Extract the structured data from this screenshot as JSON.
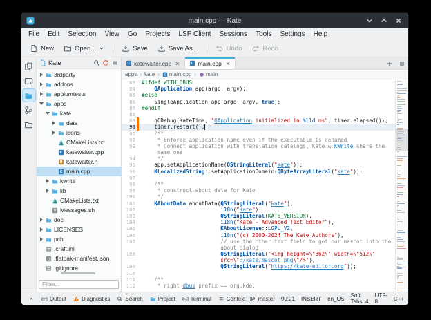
{
  "window": {
    "title": "main.cpp — Kate"
  },
  "menubar": {
    "items": [
      "File",
      "Edit",
      "Selection",
      "View",
      "Go",
      "Projects",
      "LSP Client",
      "Sessions",
      "Tools",
      "Settings",
      "Help"
    ]
  },
  "toolbar": {
    "buttons": [
      {
        "icon": "page",
        "label": "New"
      },
      {
        "icon": "folderdark",
        "label": "Open...",
        "dropdown": true
      },
      {
        "sep": true
      },
      {
        "icon": "save",
        "label": "Save"
      },
      {
        "icon": "save",
        "label": "Save As..."
      },
      {
        "sep": true
      },
      {
        "icon": "undo",
        "label": "Undo",
        "disabled": true
      },
      {
        "icon": "redo",
        "label": "Redo",
        "disabled": true
      }
    ]
  },
  "toolstrip": {
    "items": [
      {
        "name": "documents",
        "icon": "docs"
      },
      {
        "name": "filesystem",
        "icon": "drive"
      },
      {
        "name": "projects",
        "icon": "projects",
        "active": true
      },
      {
        "name": "git",
        "icon": "git"
      },
      {
        "name": "files",
        "icon": "folderdark"
      }
    ]
  },
  "project_panel": {
    "name": "Kate",
    "filter_placeholder": "Filter...",
    "tree": [
      {
        "d": 0,
        "x": "c",
        "i": "folder",
        "label": "3rdparty"
      },
      {
        "d": 0,
        "x": "c",
        "i": "folder",
        "label": "addons"
      },
      {
        "d": 0,
        "x": "c",
        "i": "folder",
        "label": "appiumtests"
      },
      {
        "d": 0,
        "x": "e",
        "i": "folder",
        "label": "apps"
      },
      {
        "d": 1,
        "x": "e",
        "i": "folder",
        "label": "kate"
      },
      {
        "d": 2,
        "x": "c",
        "i": "folder",
        "label": "data"
      },
      {
        "d": 2,
        "x": "c",
        "i": "folder",
        "label": "icons"
      },
      {
        "d": 2,
        "x": "",
        "i": "cmake",
        "label": "CMakeLists.txt"
      },
      {
        "d": 2,
        "x": "",
        "i": "cpp",
        "label": "katewaiter.cpp"
      },
      {
        "d": 2,
        "x": "",
        "i": "h",
        "label": "katewaiter.h"
      },
      {
        "d": 2,
        "x": "",
        "i": "cpp",
        "label": "main.cpp",
        "selected": true
      },
      {
        "d": 1,
        "x": "c",
        "i": "folder",
        "label": "kwrite"
      },
      {
        "d": 1,
        "x": "c",
        "i": "folder",
        "label": "lib"
      },
      {
        "d": 1,
        "x": "",
        "i": "cmake",
        "label": "CMakeLists.txt"
      },
      {
        "d": 1,
        "x": "",
        "i": "sh",
        "label": "Messages.sh"
      },
      {
        "d": 0,
        "x": "c",
        "i": "folder",
        "label": "doc"
      },
      {
        "d": 0,
        "x": "c",
        "i": "folder",
        "label": "LICENSES"
      },
      {
        "d": 0,
        "x": "c",
        "i": "folder",
        "label": "pch"
      },
      {
        "d": 0,
        "x": "",
        "i": "ini",
        "label": ".craft.ini"
      },
      {
        "d": 0,
        "x": "",
        "i": "json",
        "label": ".flatpak-manifest.json"
      },
      {
        "d": 0,
        "x": "",
        "i": "ini",
        "label": ".gitignore"
      }
    ]
  },
  "editor": {
    "tabs": [
      {
        "label": "katewaiter.cpp"
      },
      {
        "label": "main.cpp",
        "active": true
      }
    ],
    "breadcrumb_separator": "›",
    "breadcrumb": [
      {
        "label": "apps"
      },
      {
        "label": "kate"
      },
      {
        "label": "main.cpp",
        "icon": "cpp"
      },
      {
        "label": "main",
        "icon": "symbol"
      }
    ],
    "lines": [
      {
        "n": "83",
        "seg": [
          [
            "pre",
            "#ifdef WITH_DBUS"
          ]
        ]
      },
      {
        "n": "84",
        "seg": [
          [
            "pln",
            "    "
          ],
          [
            "type",
            "QApplication"
          ],
          [
            "pln",
            " app(argc, argv);"
          ]
        ]
      },
      {
        "n": "85",
        "seg": [
          [
            "pre",
            "#else"
          ]
        ]
      },
      {
        "n": "86",
        "seg": [
          [
            "pln",
            "    SingleApplication app(argc, argv, "
          ],
          [
            "kw",
            "true"
          ],
          [
            "pln",
            ");"
          ]
        ]
      },
      {
        "n": "87",
        "seg": [
          [
            "pre",
            "#endif"
          ]
        ]
      },
      {
        "n": "88",
        "seg": []
      },
      {
        "n": "89",
        "mark": true,
        "seg": [
          [
            "pln",
            "    qCDebug(KateTime, "
          ],
          [
            "str",
            "\""
          ],
          [
            "slink",
            "QApplication"
          ],
          [
            "str",
            " initialized in "
          ],
          [
            "fmt",
            "%lld"
          ],
          [
            "str",
            " ms\""
          ],
          [
            "pln",
            ", timer.elapsed());"
          ]
        ]
      },
      {
        "n": "90",
        "cur": true,
        "mark": true,
        "caret": true,
        "seg": [
          [
            "pln",
            "    timer.restart();"
          ]
        ]
      },
      {
        "n": "91",
        "seg": [
          [
            "com",
            "    /**"
          ]
        ]
      },
      {
        "n": "92",
        "seg": [
          [
            "com",
            "     * Enforce application name even if the executable is renamed"
          ]
        ]
      },
      {
        "n": "93",
        "seg": [
          [
            "com",
            "     * Connect application with translation catalogs, Kate & "
          ],
          [
            "comlink",
            "KWrite"
          ],
          [
            "com",
            " share the"
          ]
        ]
      },
      {
        "n": "",
        "seg": [
          [
            "com",
            "     same one"
          ]
        ]
      },
      {
        "n": "94",
        "seg": [
          [
            "com",
            "     */"
          ]
        ]
      },
      {
        "n": "95",
        "seg": [
          [
            "pln",
            "    app.setApplicationName("
          ],
          [
            "type",
            "QStringLiteral"
          ],
          [
            "pln",
            "("
          ],
          [
            "str",
            "\""
          ],
          [
            "slink",
            "kate"
          ],
          [
            "str",
            "\""
          ],
          [
            "pln",
            "));"
          ]
        ]
      },
      {
        "n": "96",
        "seg": [
          [
            "pln",
            "    "
          ],
          [
            "type",
            "KLocalizedString"
          ],
          [
            "pln",
            "::setApplicationDomain("
          ],
          [
            "type",
            "QByteArrayLiteral"
          ],
          [
            "pln",
            "("
          ],
          [
            "str",
            "\""
          ],
          [
            "slink",
            "kate"
          ],
          [
            "str",
            "\""
          ],
          [
            "pln",
            "));"
          ]
        ]
      },
      {
        "n": "97",
        "seg": []
      },
      {
        "n": "98",
        "seg": [
          [
            "com",
            "    /**"
          ]
        ]
      },
      {
        "n": "99",
        "seg": [
          [
            "com",
            "     * construct about data for Kate"
          ]
        ]
      },
      {
        "n": "100",
        "seg": [
          [
            "com",
            "     */"
          ]
        ]
      },
      {
        "n": "101",
        "seg": [
          [
            "pln",
            "    "
          ],
          [
            "type",
            "KAboutData"
          ],
          [
            "pln",
            " aboutData("
          ],
          [
            "type",
            "QStringLiteral"
          ],
          [
            "pln",
            "("
          ],
          [
            "str",
            "\""
          ],
          [
            "slink",
            "kate"
          ],
          [
            "str",
            "\""
          ],
          [
            "pln",
            "),"
          ]
        ]
      },
      {
        "n": "102",
        "seg": [
          [
            "pln",
            "                         "
          ],
          [
            "fn",
            "i18n"
          ],
          [
            "pln",
            "("
          ],
          [
            "str",
            "\""
          ],
          [
            "slink",
            "Kate"
          ],
          [
            "str",
            "\""
          ],
          [
            "pln",
            "),"
          ]
        ]
      },
      {
        "n": "103",
        "seg": [
          [
            "pln",
            "                         "
          ],
          [
            "type",
            "QStringLiteral"
          ],
          [
            "pln",
            "("
          ],
          [
            "macro",
            "KATE_VERSION"
          ],
          [
            "pln",
            "),"
          ]
        ]
      },
      {
        "n": "104",
        "seg": [
          [
            "pln",
            "                         "
          ],
          [
            "fn",
            "i18n"
          ],
          [
            "pln",
            "("
          ],
          [
            "str",
            "\"Kate - Advanced Text Editor\""
          ],
          [
            "pln",
            "),"
          ]
        ]
      },
      {
        "n": "105",
        "seg": [
          [
            "pln",
            "                         "
          ],
          [
            "type",
            "KAboutLicense"
          ],
          [
            "pln",
            "::"
          ],
          [
            "enum",
            "LGPL_V2"
          ],
          [
            "pln",
            ","
          ]
        ]
      },
      {
        "n": "106",
        "seg": [
          [
            "pln",
            "                         "
          ],
          [
            "fn",
            "i18n"
          ],
          [
            "pln",
            "("
          ],
          [
            "str",
            "\"(c) 2000-2024 The Kate Authors\""
          ],
          [
            "pln",
            "),"
          ]
        ]
      },
      {
        "n": "107",
        "seg": [
          [
            "com",
            "                         // use the other text field to get our mascot into the"
          ]
        ]
      },
      {
        "n": "",
        "seg": [
          [
            "com",
            "                         about dialog"
          ]
        ]
      },
      {
        "n": "108",
        "seg": [
          [
            "pln",
            "                         "
          ],
          [
            "type",
            "QStringLiteral"
          ],
          [
            "pln",
            "("
          ],
          [
            "str",
            "\"<img height=\\\"362\\\" width=\\\"512\\\""
          ]
        ]
      },
      {
        "n": "",
        "seg": [
          [
            "str",
            "                         src=\\\""
          ],
          [
            "slink",
            ":/kate/mascot.png"
          ],
          [
            "str",
            "\\\"/>\""
          ],
          [
            "pln",
            "),"
          ]
        ]
      },
      {
        "n": "109",
        "seg": [
          [
            "pln",
            "                         "
          ],
          [
            "type",
            "QStringLiteral"
          ],
          [
            "pln",
            "("
          ],
          [
            "str",
            "\""
          ],
          [
            "slink",
            "https://kate-editor.org"
          ],
          [
            "str",
            "\""
          ],
          [
            "pln",
            "));"
          ]
        ]
      },
      {
        "n": "110",
        "seg": []
      },
      {
        "n": "111",
        "seg": [
          [
            "com",
            "    /**"
          ]
        ]
      },
      {
        "n": "112",
        "seg": [
          [
            "com",
            "     * right "
          ],
          [
            "comlink",
            "dbus"
          ],
          [
            "com",
            " prefix == org.kde."
          ]
        ]
      }
    ]
  },
  "statusbar": {
    "left": [
      {
        "name": "statusbar-expand-button",
        "icon": "chevup",
        "label": ""
      },
      {
        "name": "output-button",
        "icon": "output",
        "label": "Output"
      },
      {
        "name": "diagnostics-button",
        "icon": "warning",
        "label": "Diagnostics"
      },
      {
        "name": "search-button",
        "icon": "search",
        "label": "Search"
      },
      {
        "name": "project-button",
        "icon": "folder",
        "label": "Project"
      },
      {
        "name": "terminal-button",
        "icon": "terminal",
        "label": "Terminal"
      },
      {
        "name": "context-button",
        "icon": "context",
        "label": "Context"
      }
    ],
    "right": [
      {
        "name": "git-branch-status",
        "icon": "branch",
        "label": "master"
      },
      {
        "name": "cursor-position-status",
        "label": "90:21"
      },
      {
        "name": "input-mode-status",
        "label": "INSERT"
      },
      {
        "name": "dictionary-status",
        "label": "en_US"
      },
      {
        "name": "tab-settings-status",
        "label": "Soft Tabs: 4"
      },
      {
        "name": "encoding-status",
        "label": "UTF-8"
      },
      {
        "name": "syntax-mode-status",
        "label": "C++"
      }
    ]
  },
  "colors": {
    "accent": "#3daee2",
    "warning": "#f67400",
    "titlebar": "#2b3036"
  }
}
